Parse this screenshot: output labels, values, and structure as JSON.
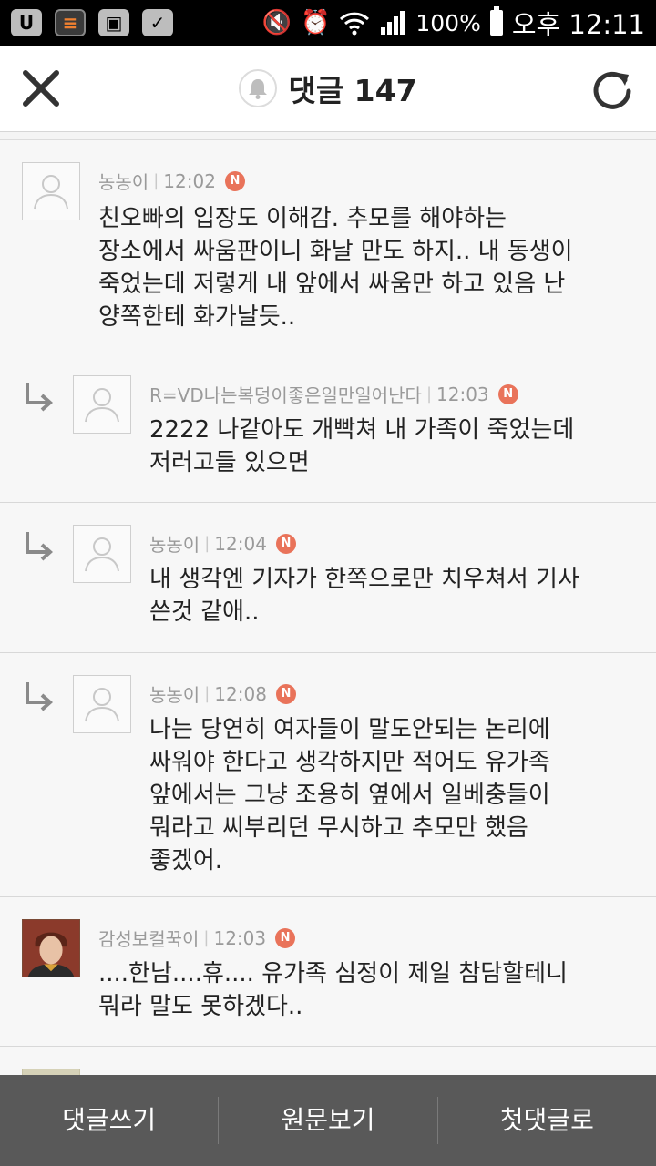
{
  "status_bar": {
    "battery": "100%",
    "time": "오후 12:11",
    "icons": [
      "u-plus-app-icon",
      "notes-app-icon",
      "gallery-icon",
      "clipboard-icon",
      "mute-icon",
      "alarm-icon",
      "wifi-icon",
      "signal-icon",
      "battery-icon"
    ]
  },
  "header": {
    "title": "댓글 147",
    "icons": [
      "close-icon",
      "bell-icon",
      "refresh-icon"
    ]
  },
  "new_badge": "N",
  "comments": [
    {
      "author": "농농이",
      "time": "12:02",
      "reply": false,
      "text": "친오빠의 입장도 이해감. 추모를 해야하는\n장소에서 싸움판이니 화날 만도 하지.. 내 동생이\n죽었는데 저렇게 내 앞에서 싸움만 하고 있음 난\n양쪽한테 화가날듯.."
    },
    {
      "author": "R=VD나는복덩이좋은일만일어난다",
      "time": "12:03",
      "reply": true,
      "text": "2222 나같아도 개빡쳐 내 가족이 죽었는데\n저러고들 있으면"
    },
    {
      "author": "농농이",
      "time": "12:04",
      "reply": true,
      "text": "내 생각엔 기자가 한쪽으로만 치우쳐서 기사\n쓴것 같애.."
    },
    {
      "author": "농농이",
      "time": "12:08",
      "reply": true,
      "text": "나는 당연히 여자들이 말도안되는 논리에\n싸워야 한다고 생각하지만 적어도 유가족\n앞에서는 그냥 조용히 옆에서 일베충들이\n뭐라고 씨부리던 무시하고 추모만 했음\n좋겠어."
    },
    {
      "author": "감성보컬꾹이",
      "time": "12:03",
      "reply": false,
      "text": "....한남....휴.... 유가족 심정이 제일 참담할테니\n뭐라 말도 못하겠다.."
    }
  ],
  "bottom_bar": {
    "write": "댓글쓰기",
    "original": "원문보기",
    "first": "첫댓글로"
  }
}
